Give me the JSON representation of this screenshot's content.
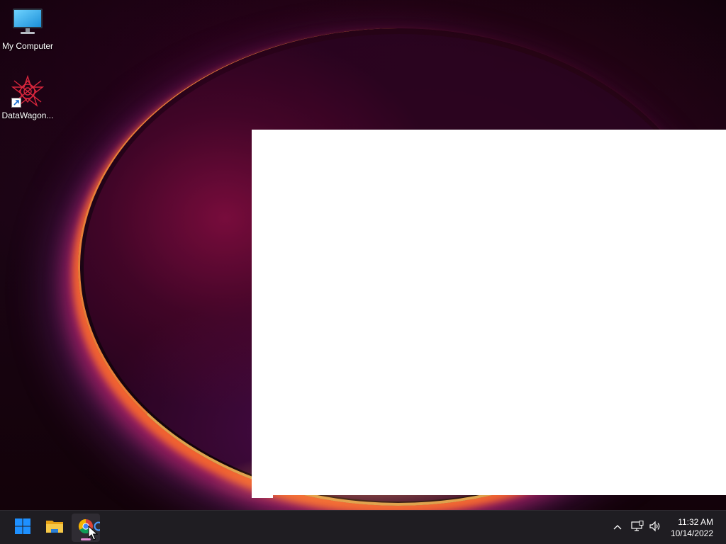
{
  "desktop": {
    "icons": [
      {
        "label": "My Computer",
        "icon": "monitor-icon"
      },
      {
        "label": "DataWagon...",
        "icon": "datawagon-app-icon",
        "shortcut": true
      }
    ]
  },
  "window": {
    "content": ""
  },
  "taskbar": {
    "buttons": [
      {
        "name": "start",
        "icon": "windows-logo-icon"
      },
      {
        "name": "file-explorer",
        "icon": "folder-icon"
      },
      {
        "name": "chrome",
        "icon": "chrome-icon",
        "active": true
      }
    ],
    "tray": {
      "overflow_icon": "chevron-up-icon",
      "network_icon": "network-icon",
      "volume_icon": "volume-icon"
    },
    "clock": {
      "time": "11:32 AM",
      "date": "10/14/2022"
    }
  },
  "colors": {
    "taskbar_bg": "#1f1d22",
    "windows_blue": "#1e90ff",
    "folder_yellow": "#f7c948",
    "active_indicator": "#e38bd4"
  }
}
